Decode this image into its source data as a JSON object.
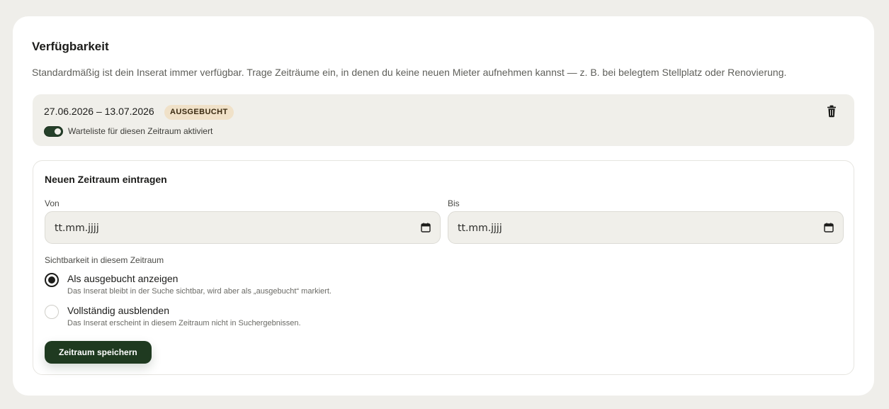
{
  "section": {
    "title": "Verfügbarkeit",
    "description": "Standardmäßig ist dein Inserat immer verfügbar. Trage Zeiträume ein, in denen du keine neuen Mieter aufnehmen kannst — z. B. bei belegtem Stellplatz oder Renovierung."
  },
  "existing_period": {
    "range": "27.06.2026 – 13.07.2026",
    "badge": "AUSGEBUCHT",
    "waitlist_label": "Warteliste für diesen Zeitraum aktiviert",
    "waitlist_enabled": true,
    "delete_icon": "trash-icon"
  },
  "new_period": {
    "title": "Neuen Zeitraum eintragen",
    "from_label": "Von",
    "from_placeholder": "tt.mm.jjjj",
    "to_label": "Bis",
    "to_placeholder": "tt.mm.jjjj",
    "visibility_label": "Sichtbarkeit in diesem Zeitraum",
    "options": [
      {
        "title": "Als ausgebucht anzeigen",
        "subtitle": "Das Inserat bleibt in der Suche sichtbar, wird aber als „ausgebucht“ markiert.",
        "selected": true
      },
      {
        "title": "Vollständig ausblenden",
        "subtitle": "Das Inserat erscheint in diesem Zeitraum nicht in Suchergebnissen.",
        "selected": false
      }
    ],
    "save_label": "Zeitraum speichern"
  },
  "colors": {
    "accent": "#1f3a20",
    "badge_bg": "#f0e1c8",
    "panel_bg": "#f0efea"
  }
}
